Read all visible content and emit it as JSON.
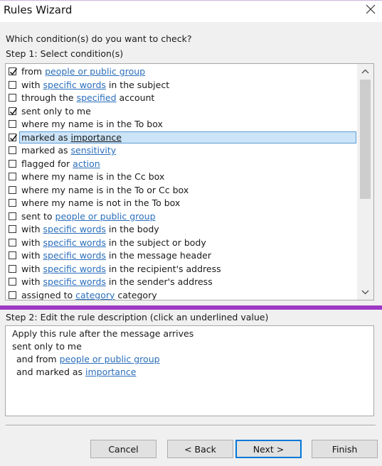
{
  "window": {
    "title": "Rules Wizard"
  },
  "prompt": "Which condition(s) do you want to check?",
  "step1": {
    "label": "Step 1: Select condition(s)",
    "conditions": [
      {
        "checked": true,
        "selected": false,
        "parts": [
          {
            "t": "from "
          },
          {
            "t": "people or public group",
            "link": true
          }
        ]
      },
      {
        "checked": false,
        "selected": false,
        "parts": [
          {
            "t": "with "
          },
          {
            "t": "specific words",
            "link": true
          },
          {
            "t": " in the subject"
          }
        ]
      },
      {
        "checked": false,
        "selected": false,
        "parts": [
          {
            "t": "through the "
          },
          {
            "t": "specified",
            "link": true
          },
          {
            "t": " account"
          }
        ]
      },
      {
        "checked": true,
        "selected": false,
        "parts": [
          {
            "t": "sent only to me"
          }
        ]
      },
      {
        "checked": false,
        "selected": false,
        "parts": [
          {
            "t": "where my name is in the To box"
          }
        ]
      },
      {
        "checked": true,
        "selected": true,
        "parts": [
          {
            "t": "marked as "
          },
          {
            "t": "importance",
            "link": true
          }
        ]
      },
      {
        "checked": false,
        "selected": false,
        "parts": [
          {
            "t": "marked as "
          },
          {
            "t": "sensitivity",
            "link": true
          }
        ]
      },
      {
        "checked": false,
        "selected": false,
        "parts": [
          {
            "t": "flagged for "
          },
          {
            "t": "action",
            "link": true
          }
        ]
      },
      {
        "checked": false,
        "selected": false,
        "parts": [
          {
            "t": "where my name is in the Cc box"
          }
        ]
      },
      {
        "checked": false,
        "selected": false,
        "parts": [
          {
            "t": "where my name is in the To or Cc box"
          }
        ]
      },
      {
        "checked": false,
        "selected": false,
        "parts": [
          {
            "t": "where my name is not in the To box"
          }
        ]
      },
      {
        "checked": false,
        "selected": false,
        "parts": [
          {
            "t": "sent to "
          },
          {
            "t": "people or public group",
            "link": true
          }
        ]
      },
      {
        "checked": false,
        "selected": false,
        "parts": [
          {
            "t": "with "
          },
          {
            "t": "specific words",
            "link": true
          },
          {
            "t": " in the body"
          }
        ]
      },
      {
        "checked": false,
        "selected": false,
        "parts": [
          {
            "t": "with "
          },
          {
            "t": "specific words",
            "link": true
          },
          {
            "t": " in the subject or body"
          }
        ]
      },
      {
        "checked": false,
        "selected": false,
        "parts": [
          {
            "t": "with "
          },
          {
            "t": "specific words",
            "link": true
          },
          {
            "t": " in the message header"
          }
        ]
      },
      {
        "checked": false,
        "selected": false,
        "parts": [
          {
            "t": "with "
          },
          {
            "t": "specific words",
            "link": true
          },
          {
            "t": " in the recipient's address"
          }
        ]
      },
      {
        "checked": false,
        "selected": false,
        "parts": [
          {
            "t": "with "
          },
          {
            "t": "specific words",
            "link": true
          },
          {
            "t": " in the sender's address"
          }
        ]
      },
      {
        "checked": false,
        "selected": false,
        "parts": [
          {
            "t": "assigned to "
          },
          {
            "t": "category",
            "link": true
          },
          {
            "t": " category"
          }
        ]
      }
    ]
  },
  "step2": {
    "label": "Step 2: Edit the rule description (click an underlined value)",
    "lines": [
      {
        "indent": 0,
        "parts": [
          {
            "t": "Apply this rule after the message arrives"
          }
        ]
      },
      {
        "indent": 0,
        "parts": [
          {
            "t": "sent only to me"
          }
        ]
      },
      {
        "indent": 1,
        "parts": [
          {
            "t": "and from "
          },
          {
            "t": "people or public group",
            "link": true
          }
        ]
      },
      {
        "indent": 1,
        "parts": [
          {
            "t": "and marked as "
          },
          {
            "t": "importance",
            "link": true
          }
        ]
      }
    ]
  },
  "buttons": {
    "cancel": "Cancel",
    "back": "< Back",
    "next": "Next >",
    "finish": "Finish"
  },
  "colors": {
    "link": "#2a6ebb",
    "selection": "#cce4f7",
    "accent_bar": "#9e39c6",
    "default_button_border": "#0078d7"
  }
}
